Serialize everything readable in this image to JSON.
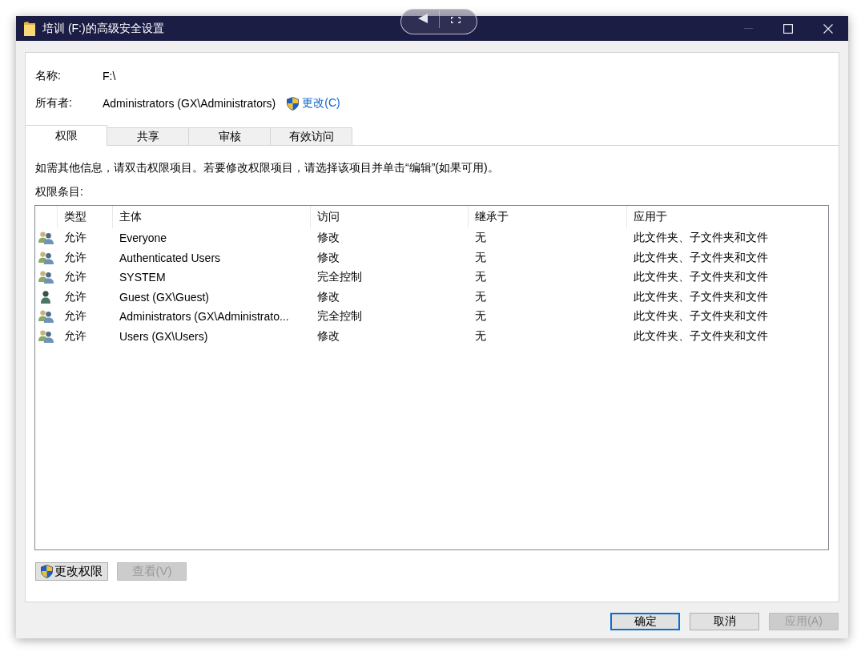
{
  "window": {
    "title": "培训 (F:)的高级安全设置"
  },
  "properties": [
    {
      "label": "名称:",
      "value": "F:\\"
    },
    {
      "label": "所有者:",
      "value": "Administrators (GX\\Administrators)",
      "link": "更改(C)"
    }
  ],
  "tabs": [
    {
      "label": "权限",
      "selected": true
    },
    {
      "label": "共享",
      "selected": false
    },
    {
      "label": "审核",
      "selected": false
    },
    {
      "label": "有效访问",
      "selected": false
    }
  ],
  "instructions": "如需其他信息，请双击权限项目。若要修改权限项目，请选择该项目并单击“编辑”(如果可用)。",
  "entries_label": "权限条目:",
  "table": {
    "columns": [
      "类型",
      "主体",
      "访问",
      "继承于",
      "应用于"
    ],
    "rows": [
      {
        "kind": "group",
        "selected": false,
        "cells": [
          "允许",
          "Everyone",
          "修改",
          "无",
          "此文件夹、子文件夹和文件"
        ]
      },
      {
        "kind": "group",
        "selected": false,
        "cells": [
          "允许",
          "Authenticated Users",
          "修改",
          "无",
          "此文件夹、子文件夹和文件"
        ]
      },
      {
        "kind": "group",
        "selected": false,
        "cells": [
          "允许",
          "SYSTEM",
          "完全控制",
          "无",
          "此文件夹、子文件夹和文件"
        ]
      },
      {
        "kind": "user",
        "selected": false,
        "cells": [
          "允许",
          "Guest (GX\\Guest)",
          "修改",
          "无",
          "此文件夹、子文件夹和文件"
        ]
      },
      {
        "kind": "group",
        "selected": false,
        "cells": [
          "允许",
          "Administrators (GX\\Administrato...",
          "完全控制",
          "无",
          "此文件夹、子文件夹和文件"
        ]
      },
      {
        "kind": "group",
        "selected": false,
        "cells": [
          "允许",
          "Users (GX\\Users)",
          "修改",
          "无",
          "此文件夹、子文件夹和文件"
        ]
      }
    ]
  },
  "actions": [
    {
      "label": "更改权限",
      "shield": true,
      "disabled": false
    },
    {
      "label": "查看(V)",
      "shield": false,
      "disabled": true
    }
  ],
  "dialog_buttons": [
    {
      "label": "确定",
      "default": true,
      "disabled": false
    },
    {
      "label": "取消",
      "default": false,
      "disabled": false
    },
    {
      "label": "应用(A)",
      "default": false,
      "disabled": true
    }
  ]
}
